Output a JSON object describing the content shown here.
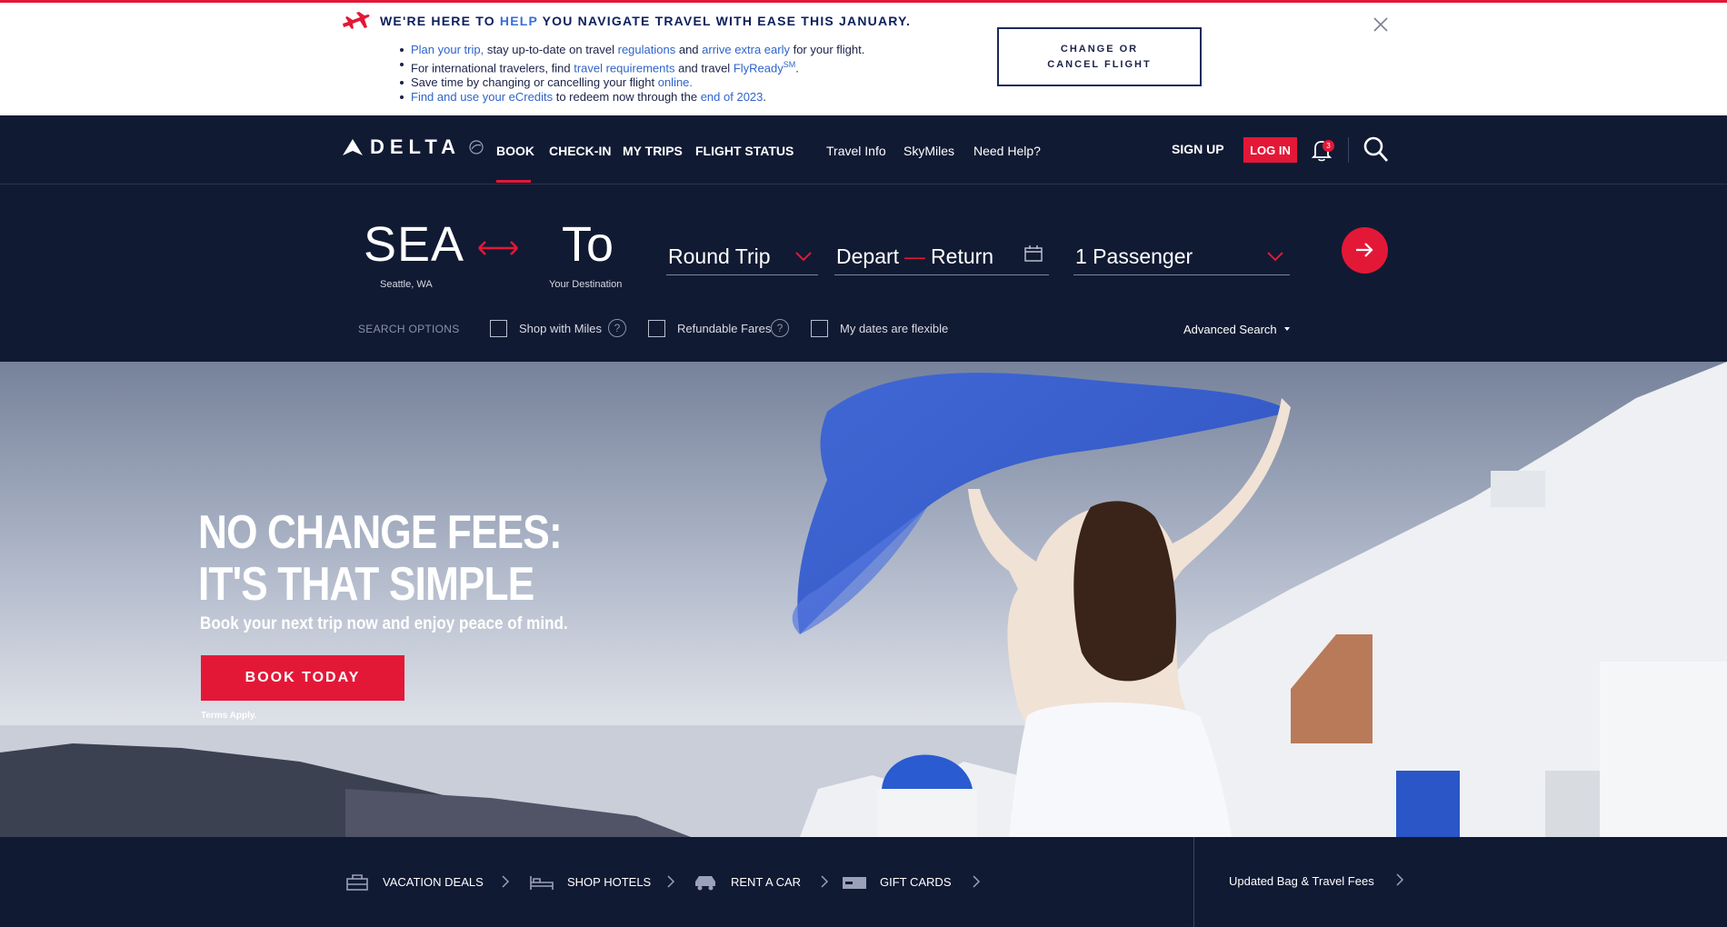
{
  "alert": {
    "title_pre": "WE'RE HERE TO ",
    "title_hl": "HELP",
    "title_post": " YOU NAVIGATE TRAVEL WITH EASE THIS JANUARY.",
    "lines": [
      [
        {
          "t": "Plan your trip,",
          "link": true
        },
        {
          "t": " stay up-to-date on travel "
        },
        {
          "t": "regulations",
          "link": true
        },
        {
          "t": " and "
        },
        {
          "t": "arrive extra early",
          "link": true
        },
        {
          "t": " for your flight."
        }
      ],
      [
        {
          "t": "For international travelers, find "
        },
        {
          "t": "travel requirements",
          "link": true
        },
        {
          "t": " and travel "
        },
        {
          "t": "FlyReady",
          "link": true
        },
        {
          "t": "SM",
          "link": true,
          "sup": true
        },
        {
          "t": "."
        }
      ],
      [
        {
          "t": "Save time by changing or cancelling your flight "
        },
        {
          "t": "online.",
          "link": true
        }
      ],
      [
        {
          "t": "Find and use your eCredits",
          "link": true
        },
        {
          "t": " to redeem now through the "
        },
        {
          "t": "end of 2023",
          "link": true
        },
        {
          "t": "."
        }
      ]
    ],
    "change_button": "CHANGE OR CANCEL FLIGHT"
  },
  "nav": {
    "logo_text": "DELTA",
    "primary": [
      "BOOK",
      "CHECK-IN",
      "MY TRIPS",
      "FLIGHT STATUS"
    ],
    "secondary": [
      "Travel Info",
      "SkyMiles",
      "Need Help?"
    ],
    "sign_up": "SIGN UP",
    "log_in": "LOG IN",
    "notification_count": "3"
  },
  "booking": {
    "origin_code": "SEA",
    "origin_city": "Seattle, WA",
    "dest_code": "To",
    "dest_label": "Your Destination",
    "trip_type": "Round Trip",
    "depart": "Depart",
    "return": "Return",
    "passengers": "1 Passenger",
    "search_options_label": "SEARCH OPTIONS",
    "options": [
      "Shop with Miles",
      "Refundable Fares",
      "My dates are flexible"
    ],
    "advanced_search": "Advanced Search"
  },
  "hero": {
    "headline_1": "NO CHANGE FEES:",
    "headline_2": "IT'S THAT SIMPLE",
    "subhead": "Book your next trip now and enjoy peace of mind.",
    "cta": "BOOK TODAY",
    "terms": "Terms Apply."
  },
  "bottom": {
    "items": [
      "VACATION DEALS",
      "SHOP HOTELS",
      "RENT A CAR",
      "GIFT CARDS"
    ],
    "right_link": "Updated Bag & Travel Fees"
  },
  "colors": {
    "brand_red": "#e31837",
    "navy": "#111a33",
    "link_blue": "#2f64c9"
  }
}
